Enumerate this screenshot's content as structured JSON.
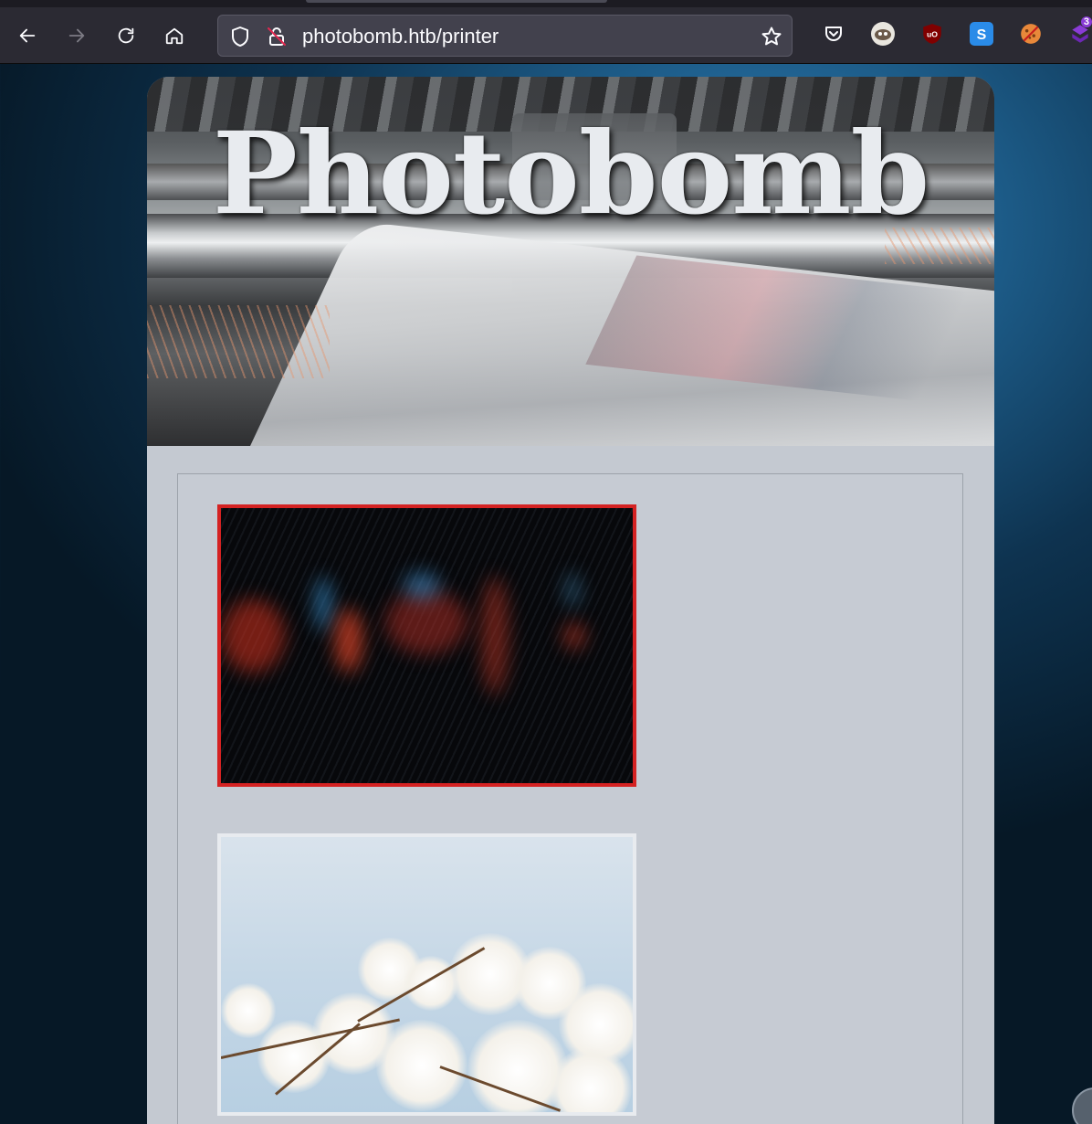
{
  "browser": {
    "url": "photobomb.htb/printer",
    "extension_badge": "3"
  },
  "page": {
    "title": "Photobomb"
  },
  "icons": {
    "back": "arrow-left-icon",
    "forward": "arrow-right-icon",
    "reload": "reload-icon",
    "home": "home-icon",
    "shield": "tracking-shield-icon",
    "lock": "insecure-lock-icon",
    "bookmark": "star-icon",
    "pocket": "pocket-icon",
    "extensions": [
      "wappalyzer-icon",
      "ublock-origin-icon",
      "s-extension-icon",
      "cookie-editor-icon",
      "hackbar-icon"
    ]
  },
  "photos": {
    "count": 2,
    "selected_index": 0
  },
  "colors": {
    "selected_border": "#d42222",
    "unselected_border": "#e8ebef",
    "card_background": "#c4c9d1"
  }
}
